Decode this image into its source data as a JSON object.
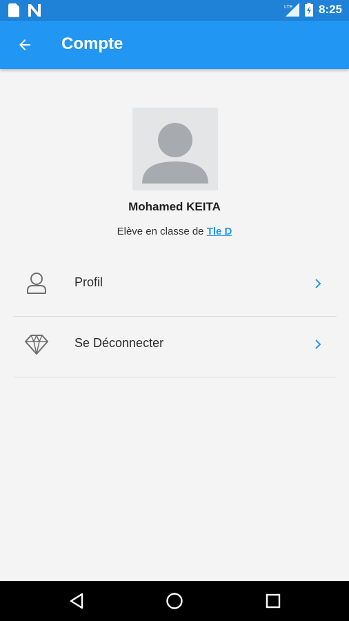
{
  "status_bar": {
    "time": "8:25",
    "icons": [
      "sim-card-icon",
      "n-notification-icon",
      "lte-signal-icon",
      "battery-icon"
    ]
  },
  "app_bar": {
    "title": "Compte",
    "back_icon": "arrow-back-icon"
  },
  "profile": {
    "avatar_icon": "person-placeholder-icon",
    "name": "Mohamed KEITA",
    "class_prefix": "Elève en classe de",
    "class_name": "Tle D"
  },
  "menu": {
    "items": [
      {
        "label": "Profil",
        "icon": "user-icon"
      },
      {
        "label": "Se Déconnecter",
        "icon": "diamond-icon"
      }
    ]
  },
  "colors": {
    "primary": "#2296f3",
    "status_bar": "#1f82d6",
    "background": "#f5f4f5"
  },
  "nav_bar": {
    "buttons": [
      "back-triangle-icon",
      "home-circle-icon",
      "recents-square-icon"
    ]
  }
}
